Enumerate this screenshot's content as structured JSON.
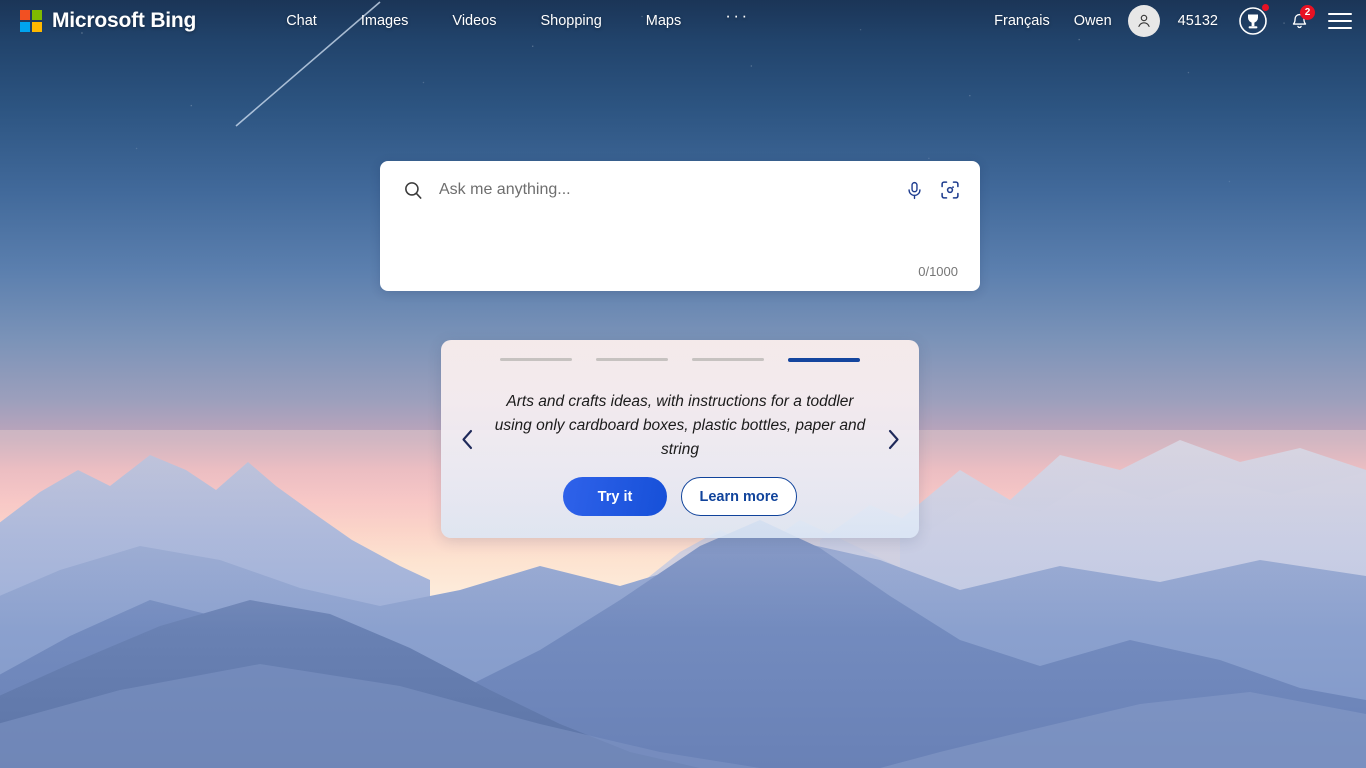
{
  "header": {
    "brand": "Microsoft Bing",
    "logo_icon": "microsoft-logo-icon",
    "nav": [
      {
        "label": "Chat"
      },
      {
        "label": "Images"
      },
      {
        "label": "Videos"
      },
      {
        "label": "Shopping"
      },
      {
        "label": "Maps"
      },
      {
        "label": "···"
      }
    ],
    "language": "Français",
    "user_name": "Owen",
    "avatar_icon": "person-icon",
    "rewards_points": "45132",
    "rewards_icon": "rewards-medal-icon",
    "notifications_icon": "bell-icon",
    "notifications_count": "2",
    "menu_icon": "hamburger-menu-icon"
  },
  "search": {
    "placeholder": "Ask me anything...",
    "value": "",
    "search_icon": "search-icon",
    "mic_icon": "microphone-icon",
    "visual_search_icon": "visual-search-camera-icon",
    "char_count": "0/1000"
  },
  "carousel": {
    "prev_icon": "chevron-left-icon",
    "next_icon": "chevron-right-icon",
    "active_index": 3,
    "slides": [
      {
        "label": "slide-1"
      },
      {
        "label": "slide-2"
      },
      {
        "label": "slide-3"
      },
      {
        "label": "slide-4"
      }
    ],
    "prompt": "Arts and crafts ideas, with instructions for a toddler using only cardboard boxes, plastic bottles, paper and string",
    "primary_button": "Try it",
    "secondary_button": "Learn more"
  },
  "colors": {
    "accent_blue": "#1650d8",
    "active_bar": "#14459e",
    "badge_red": "#e81123",
    "icon_navy": "#1f3d8f"
  }
}
